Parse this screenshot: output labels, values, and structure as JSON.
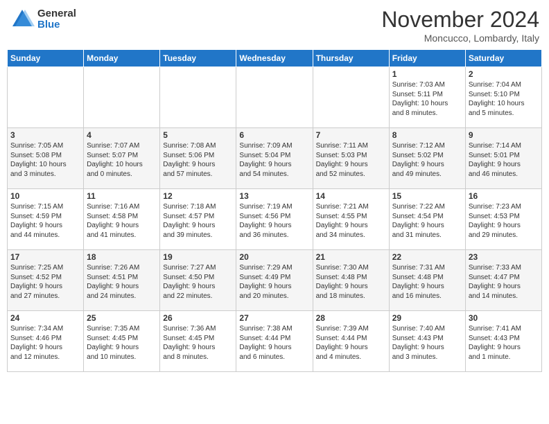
{
  "logo": {
    "general": "General",
    "blue": "Blue"
  },
  "title": "November 2024",
  "subtitle": "Moncucco, Lombardy, Italy",
  "days_header": [
    "Sunday",
    "Monday",
    "Tuesday",
    "Wednesday",
    "Thursday",
    "Friday",
    "Saturday"
  ],
  "weeks": [
    [
      {
        "day": "",
        "info": ""
      },
      {
        "day": "",
        "info": ""
      },
      {
        "day": "",
        "info": ""
      },
      {
        "day": "",
        "info": ""
      },
      {
        "day": "",
        "info": ""
      },
      {
        "day": "1",
        "info": "Sunrise: 7:03 AM\nSunset: 5:11 PM\nDaylight: 10 hours\nand 8 minutes."
      },
      {
        "day": "2",
        "info": "Sunrise: 7:04 AM\nSunset: 5:10 PM\nDaylight: 10 hours\nand 5 minutes."
      }
    ],
    [
      {
        "day": "3",
        "info": "Sunrise: 7:05 AM\nSunset: 5:08 PM\nDaylight: 10 hours\nand 3 minutes."
      },
      {
        "day": "4",
        "info": "Sunrise: 7:07 AM\nSunset: 5:07 PM\nDaylight: 10 hours\nand 0 minutes."
      },
      {
        "day": "5",
        "info": "Sunrise: 7:08 AM\nSunset: 5:06 PM\nDaylight: 9 hours\nand 57 minutes."
      },
      {
        "day": "6",
        "info": "Sunrise: 7:09 AM\nSunset: 5:04 PM\nDaylight: 9 hours\nand 54 minutes."
      },
      {
        "day": "7",
        "info": "Sunrise: 7:11 AM\nSunset: 5:03 PM\nDaylight: 9 hours\nand 52 minutes."
      },
      {
        "day": "8",
        "info": "Sunrise: 7:12 AM\nSunset: 5:02 PM\nDaylight: 9 hours\nand 49 minutes."
      },
      {
        "day": "9",
        "info": "Sunrise: 7:14 AM\nSunset: 5:01 PM\nDaylight: 9 hours\nand 46 minutes."
      }
    ],
    [
      {
        "day": "10",
        "info": "Sunrise: 7:15 AM\nSunset: 4:59 PM\nDaylight: 9 hours\nand 44 minutes."
      },
      {
        "day": "11",
        "info": "Sunrise: 7:16 AM\nSunset: 4:58 PM\nDaylight: 9 hours\nand 41 minutes."
      },
      {
        "day": "12",
        "info": "Sunrise: 7:18 AM\nSunset: 4:57 PM\nDaylight: 9 hours\nand 39 minutes."
      },
      {
        "day": "13",
        "info": "Sunrise: 7:19 AM\nSunset: 4:56 PM\nDaylight: 9 hours\nand 36 minutes."
      },
      {
        "day": "14",
        "info": "Sunrise: 7:21 AM\nSunset: 4:55 PM\nDaylight: 9 hours\nand 34 minutes."
      },
      {
        "day": "15",
        "info": "Sunrise: 7:22 AM\nSunset: 4:54 PM\nDaylight: 9 hours\nand 31 minutes."
      },
      {
        "day": "16",
        "info": "Sunrise: 7:23 AM\nSunset: 4:53 PM\nDaylight: 9 hours\nand 29 minutes."
      }
    ],
    [
      {
        "day": "17",
        "info": "Sunrise: 7:25 AM\nSunset: 4:52 PM\nDaylight: 9 hours\nand 27 minutes."
      },
      {
        "day": "18",
        "info": "Sunrise: 7:26 AM\nSunset: 4:51 PM\nDaylight: 9 hours\nand 24 minutes."
      },
      {
        "day": "19",
        "info": "Sunrise: 7:27 AM\nSunset: 4:50 PM\nDaylight: 9 hours\nand 22 minutes."
      },
      {
        "day": "20",
        "info": "Sunrise: 7:29 AM\nSunset: 4:49 PM\nDaylight: 9 hours\nand 20 minutes."
      },
      {
        "day": "21",
        "info": "Sunrise: 7:30 AM\nSunset: 4:48 PM\nDaylight: 9 hours\nand 18 minutes."
      },
      {
        "day": "22",
        "info": "Sunrise: 7:31 AM\nSunset: 4:48 PM\nDaylight: 9 hours\nand 16 minutes."
      },
      {
        "day": "23",
        "info": "Sunrise: 7:33 AM\nSunset: 4:47 PM\nDaylight: 9 hours\nand 14 minutes."
      }
    ],
    [
      {
        "day": "24",
        "info": "Sunrise: 7:34 AM\nSunset: 4:46 PM\nDaylight: 9 hours\nand 12 minutes."
      },
      {
        "day": "25",
        "info": "Sunrise: 7:35 AM\nSunset: 4:45 PM\nDaylight: 9 hours\nand 10 minutes."
      },
      {
        "day": "26",
        "info": "Sunrise: 7:36 AM\nSunset: 4:45 PM\nDaylight: 9 hours\nand 8 minutes."
      },
      {
        "day": "27",
        "info": "Sunrise: 7:38 AM\nSunset: 4:44 PM\nDaylight: 9 hours\nand 6 minutes."
      },
      {
        "day": "28",
        "info": "Sunrise: 7:39 AM\nSunset: 4:44 PM\nDaylight: 9 hours\nand 4 minutes."
      },
      {
        "day": "29",
        "info": "Sunrise: 7:40 AM\nSunset: 4:43 PM\nDaylight: 9 hours\nand 3 minutes."
      },
      {
        "day": "30",
        "info": "Sunrise: 7:41 AM\nSunset: 4:43 PM\nDaylight: 9 hours\nand 1 minute."
      }
    ]
  ]
}
